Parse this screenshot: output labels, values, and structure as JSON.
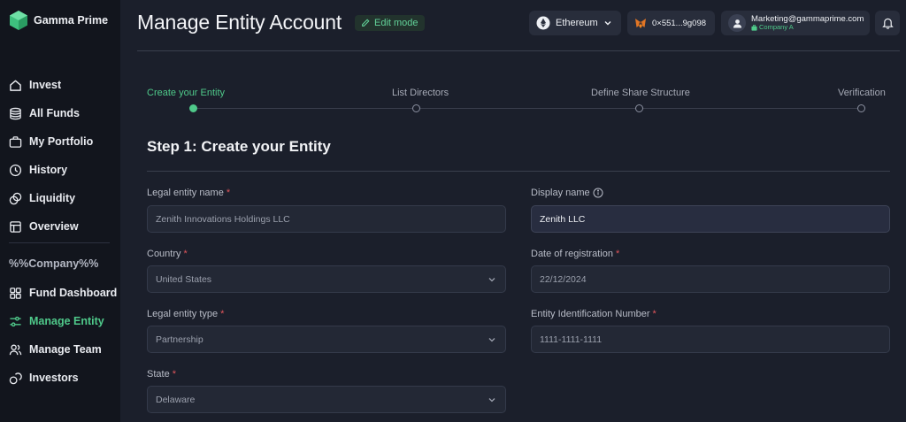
{
  "brand": {
    "name": "Gamma Prime",
    "accent": "#4fc98a"
  },
  "sidebar": {
    "items": [
      {
        "label": "Invest",
        "icon": "home-icon"
      },
      {
        "label": "All Funds",
        "icon": "coins-icon"
      },
      {
        "label": "My Portfolio",
        "icon": "briefcase-icon"
      },
      {
        "label": "History",
        "icon": "history-icon"
      },
      {
        "label": "Liquidity",
        "icon": "liquidity-icon"
      },
      {
        "label": "Overview",
        "icon": "overview-icon"
      }
    ],
    "section_label": "%%Company%%",
    "company_items": [
      {
        "label": "Fund Dashboard",
        "icon": "grid-icon"
      },
      {
        "label": "Manage Entity",
        "icon": "sliders-icon",
        "active": true
      },
      {
        "label": "Manage Team",
        "icon": "team-icon"
      },
      {
        "label": "Investors",
        "icon": "investors-icon"
      }
    ]
  },
  "header": {
    "title": "Manage Entity Account",
    "edit_badge": "Edit mode",
    "network": "Ethereum",
    "wallet": "0×551...9g098",
    "account_email": "Marketing@gammaprime.com",
    "account_company": "Company A"
  },
  "stepper": {
    "steps": [
      {
        "label": "Create your Entity",
        "active": true
      },
      {
        "label": "List Directors",
        "active": false
      },
      {
        "label": "Define Share Structure",
        "active": false
      },
      {
        "label": "Verification",
        "active": false
      }
    ]
  },
  "form": {
    "title": "Step 1: Create your Entity",
    "legal_entity_name": {
      "label": "Legal entity name",
      "value": "Zenith Innovations Holdings LLC"
    },
    "display_name": {
      "label": "Display name",
      "value": "Zenith LLC"
    },
    "country": {
      "label": "Country",
      "value": "United States"
    },
    "date_of_registration": {
      "label": "Date of registration",
      "value": "22/12/2024"
    },
    "legal_entity_type": {
      "label": "Legal entity type",
      "value": "Partnership"
    },
    "entity_identification_number": {
      "label": "Entity Identification Number",
      "value": "1111-1111-1111"
    },
    "state": {
      "label": "State",
      "value": "Delaware"
    },
    "required_marker": "*"
  }
}
